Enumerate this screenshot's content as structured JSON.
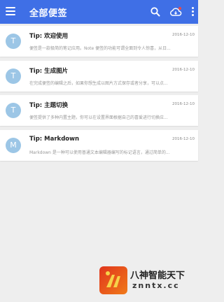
{
  "header": {
    "title": "全部便签",
    "icons": [
      "menu-icon",
      "search-icon",
      "cloud-sync-icon",
      "more-vert-icon"
    ],
    "colors": {
      "appbar": "#3f6fe6",
      "cloud_badge": "#e34b4b"
    }
  },
  "notes": [
    {
      "avatar": "T",
      "title": "Tip: 欢迎使用",
      "date": "2016-12-10",
      "preview": "便签是一款极简的笔记应用。Note 便签的功能可谓全面到令人惊喜，从日..."
    },
    {
      "avatar": "T",
      "title": "Tip: 生成图片",
      "date": "2016-12-10",
      "preview": "在完成便签的编辑之后，如果你想生成以图片方式保存或者分享，可以点..."
    },
    {
      "avatar": "T",
      "title": "Tip: 主题切换",
      "date": "2016-12-10",
      "preview": "便签提供了多种内置主题，你可以在设置界面根据自己的喜爱进行切换应..."
    },
    {
      "avatar": "M",
      "title": "Tip: Markdown",
      "date": "2016-12-10",
      "preview": "Markdown 是一种可以使用普通文本编辑器编写的标记语言，通过简单的..."
    }
  ],
  "avatar_color": "#9cc6e6",
  "watermark": {
    "title": "八神智能天下",
    "url": "znntx.cc"
  }
}
